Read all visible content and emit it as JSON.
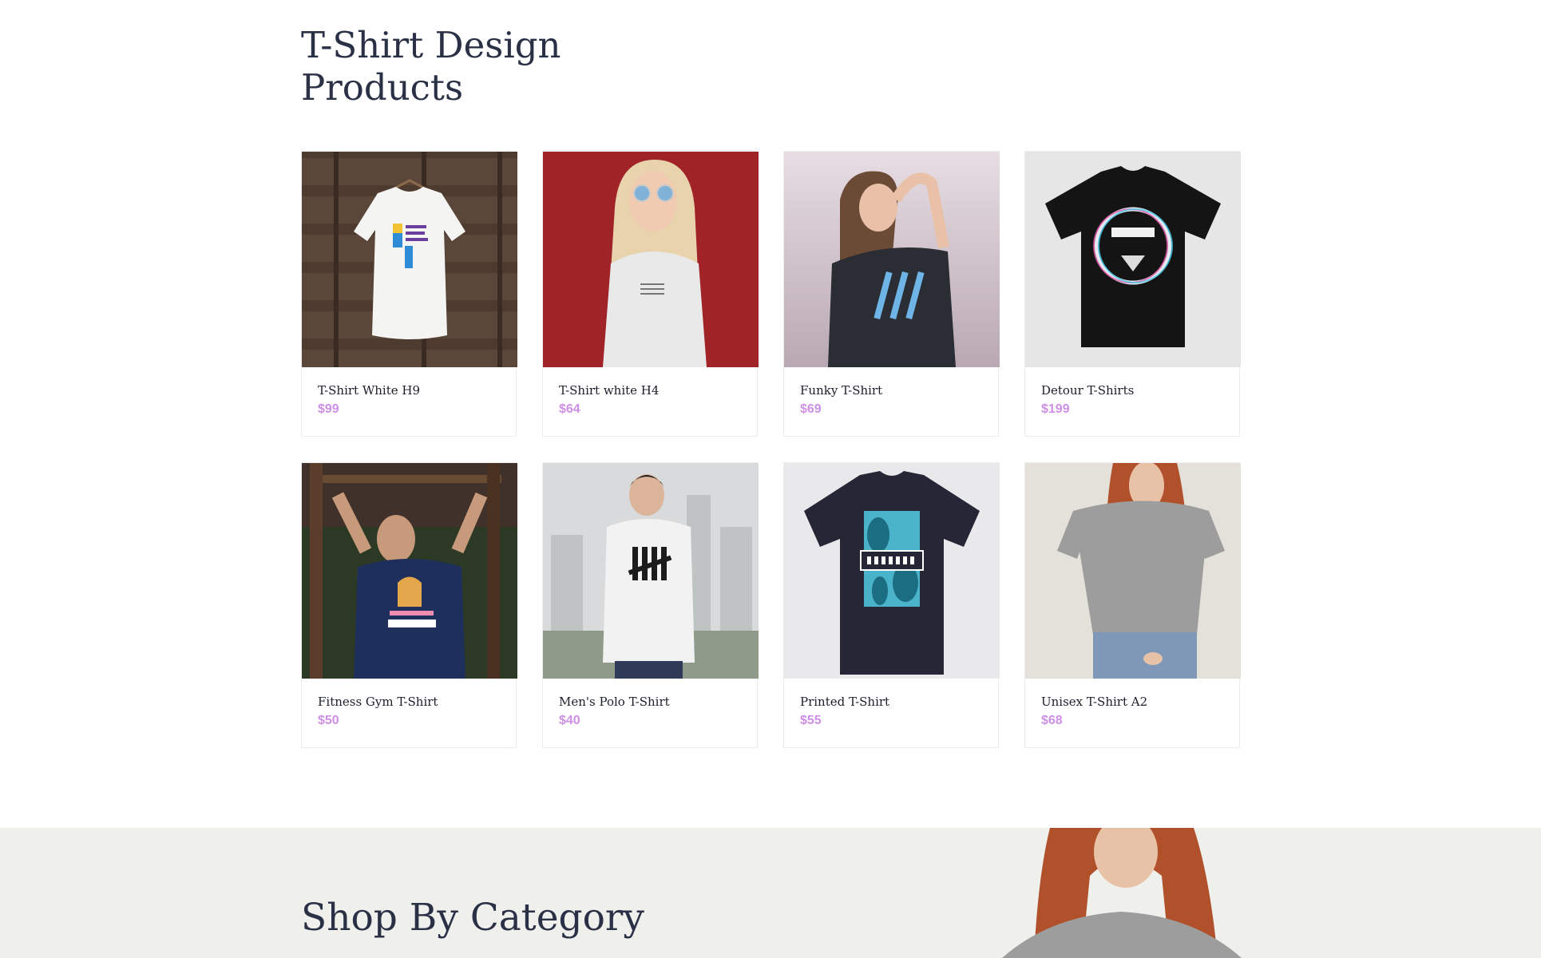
{
  "section": {
    "title_line1": "T-Shirt Design",
    "title_line2": "Products"
  },
  "products": [
    {
      "name": "T-Shirt White H9",
      "price": "$99"
    },
    {
      "name": "T-Shirt white H4",
      "price": "$64"
    },
    {
      "name": "Funky T-Shirt",
      "price": "$69"
    },
    {
      "name": "Detour T-Shirts",
      "price": "$199"
    },
    {
      "name": "Fitness Gym T-Shirt",
      "price": "$50"
    },
    {
      "name": "Men's Polo T-Shirt",
      "price": "$40"
    },
    {
      "name": "Printed T-Shirt",
      "price": "$55"
    },
    {
      "name": "Unisex T-Shirt A2",
      "price": "$68"
    }
  ],
  "category": {
    "title": "Shop By Category"
  },
  "colors": {
    "heading": "#2a3146",
    "price": "#cf8fe6",
    "card_border": "#ececef",
    "band_background": "#efefec"
  }
}
